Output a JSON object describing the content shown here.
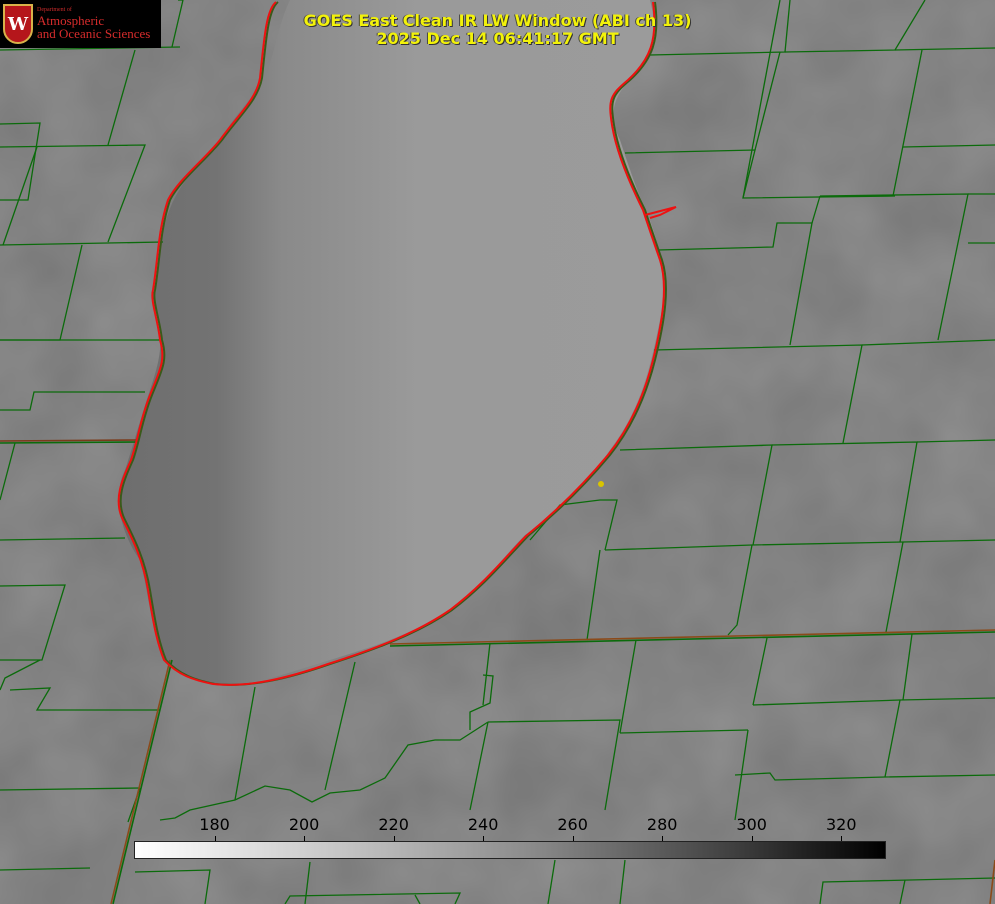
{
  "logo": {
    "department": "Department of",
    "line1": "Atmospheric",
    "line2": "and Oceanic Sciences",
    "seal_letter": "W"
  },
  "title": {
    "line1": "GOES East Clean IR LW Window (ABI ch 13)",
    "line2": "2025 Dec 14 06:41:17 GMT"
  },
  "colorbar": {
    "ticks": [
      "180",
      "200",
      "220",
      "240",
      "260",
      "280",
      "300",
      "320"
    ],
    "min_value": 180,
    "max_value": 320
  },
  "colors": {
    "county_lines": "#0b6b0b",
    "state_lines": "#7a4a1a",
    "coastline": "#ee1111",
    "title_text": "#f2f20a"
  }
}
